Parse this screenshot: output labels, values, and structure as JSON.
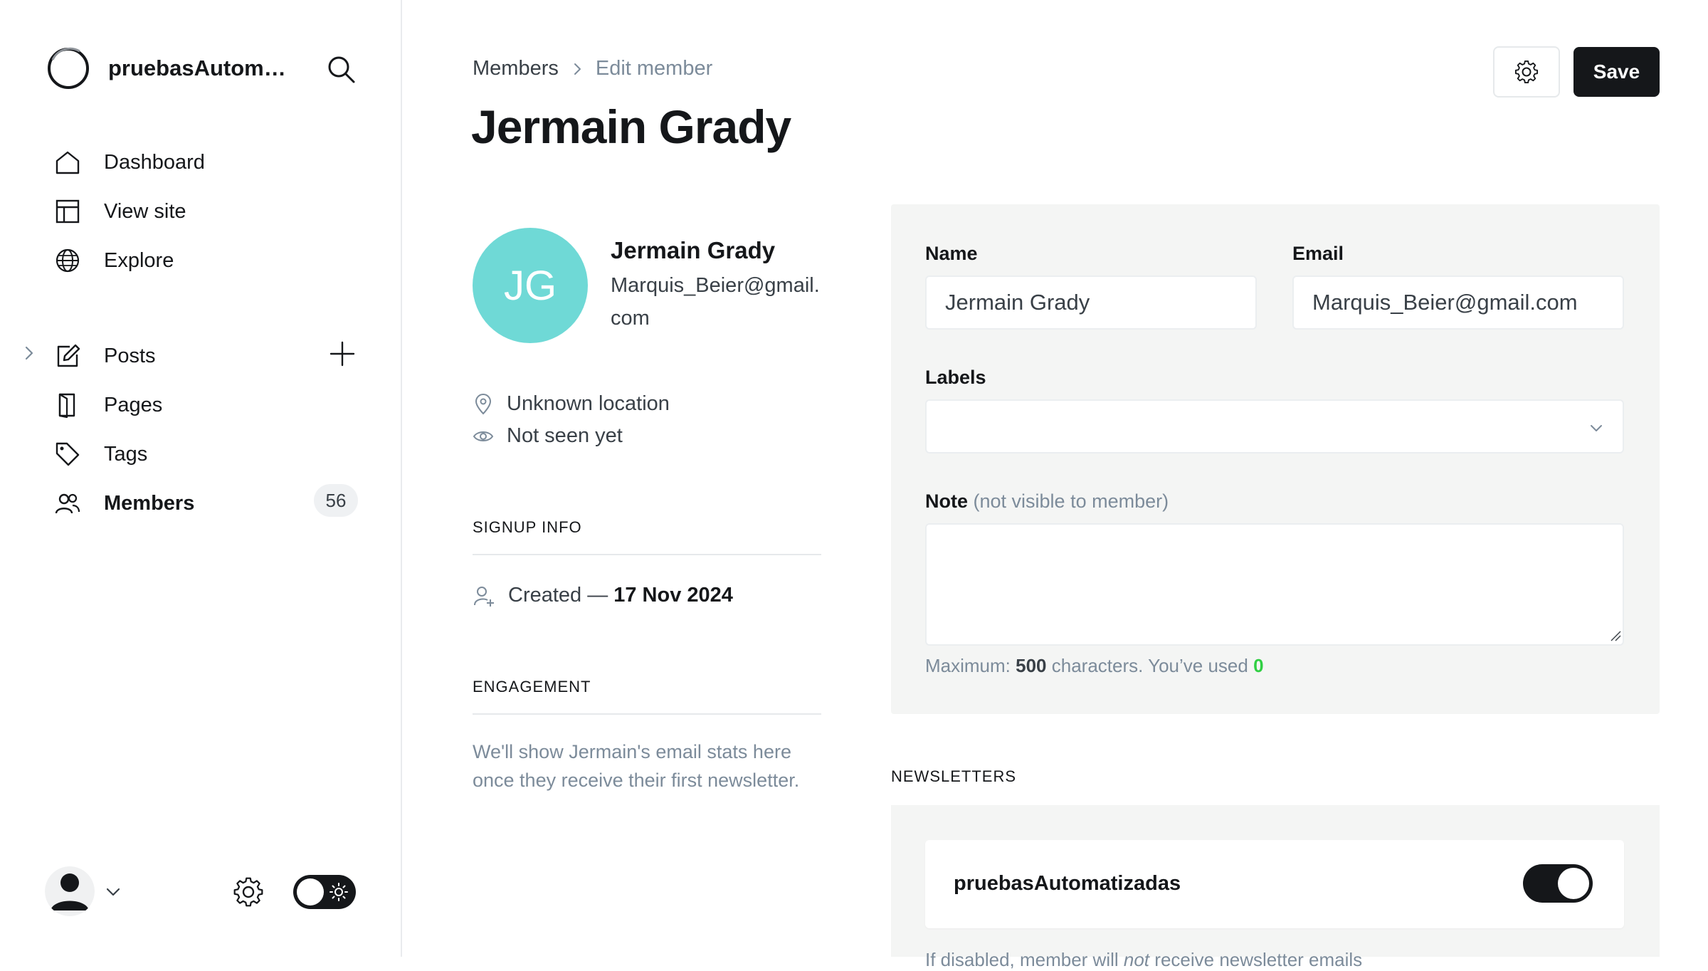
{
  "sidebar": {
    "site_name": "pruebasAutomatizadas",
    "nav_primary": [
      {
        "label": "Dashboard",
        "icon": "home-icon"
      },
      {
        "label": "View site",
        "icon": "layout-icon"
      },
      {
        "label": "Explore",
        "icon": "globe-icon"
      }
    ],
    "nav_content": [
      {
        "label": "Posts",
        "icon": "edit-icon"
      },
      {
        "label": "Pages",
        "icon": "pages-icon"
      },
      {
        "label": "Tags",
        "icon": "tag-icon"
      },
      {
        "label": "Members",
        "icon": "members-icon",
        "badge": "56",
        "active": true
      }
    ]
  },
  "header": {
    "breadcrumb_parent": "Members",
    "breadcrumb_current": "Edit member",
    "title": "Jermain Grady",
    "save_label": "Save"
  },
  "profile": {
    "initials": "JG",
    "avatar_color": "#6fd9d6",
    "name": "Jermain Grady",
    "email": "Marquis_Beier@gmail.com",
    "location": "Unknown location",
    "last_seen": "Not seen yet",
    "signup_heading": "SIGNUP INFO",
    "created_prefix": "Created —",
    "created_date": "17 Nov 2024",
    "engagement_heading": "ENGAGEMENT",
    "engagement_text": "We'll show Jermain's email stats here once they receive their first newsletter."
  },
  "form": {
    "name_label": "Name",
    "name_value": "Jermain Grady",
    "email_label": "Email",
    "email_value": "Marquis_Beier@gmail.com",
    "labels_label": "Labels",
    "note_label": "Note",
    "note_sub": "(not visible to member)",
    "note_value": "",
    "note_hint_prefix": "Maximum:",
    "note_hint_max": "500",
    "note_hint_mid": "characters. You’ve used",
    "note_hint_used": "0"
  },
  "newsletters": {
    "heading": "NEWSLETTERS",
    "items": [
      {
        "name": "pruebasAutomatizadas",
        "subscribed": true
      }
    ],
    "hint_prefix": "If disabled, member will",
    "hint_emph": "not",
    "hint_suffix": "receive newsletter emails"
  }
}
